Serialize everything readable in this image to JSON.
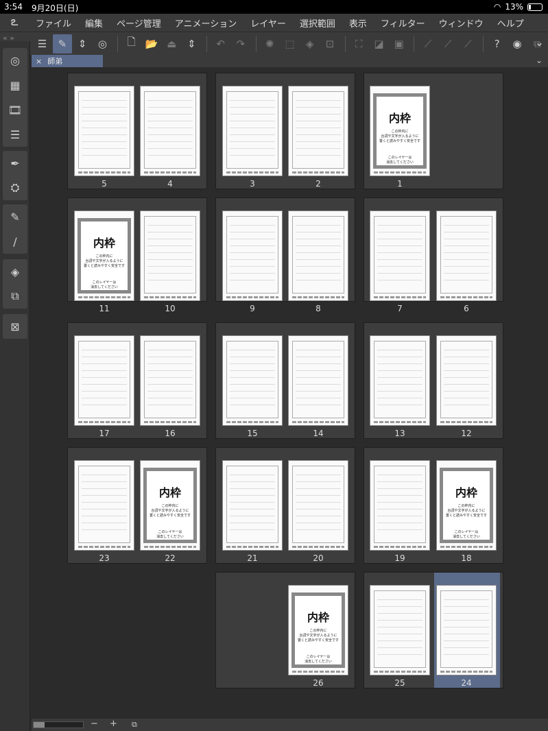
{
  "status": {
    "time": "3:54",
    "date": "9月20日(日)",
    "battery": "13%",
    "wifi_icon": "wifi-icon",
    "battery_level": 0.13
  },
  "menu": [
    "ファイル",
    "編集",
    "ページ管理",
    "アニメーション",
    "レイヤー",
    "選択範囲",
    "表示",
    "フィルター",
    "ウィンドウ",
    "ヘルプ"
  ],
  "tab": {
    "title": "師弟",
    "close": "×"
  },
  "template": {
    "big": "内枠",
    "line1": "この枠内に",
    "line2": "台詞や文字が入るように",
    "line3": "置くと読みやすく安全です",
    "line4": "このレイヤーは",
    "line5": "消去してください"
  },
  "pages": {
    "p1": "1",
    "p2": "2",
    "p3": "3",
    "p4": "4",
    "p5": "5",
    "p6": "6",
    "p7": "7",
    "p8": "8",
    "p9": "9",
    "p10": "10",
    "p11": "11",
    "p12": "12",
    "p13": "13",
    "p14": "14",
    "p15": "15",
    "p16": "16",
    "p17": "17",
    "p18": "18",
    "p19": "19",
    "p20": "20",
    "p21": "21",
    "p22": "22",
    "p23": "23",
    "p24": "24",
    "p25": "25",
    "p26": "26"
  },
  "selected_page": "24",
  "zoom": {
    "minus": "−",
    "plus": "+"
  }
}
